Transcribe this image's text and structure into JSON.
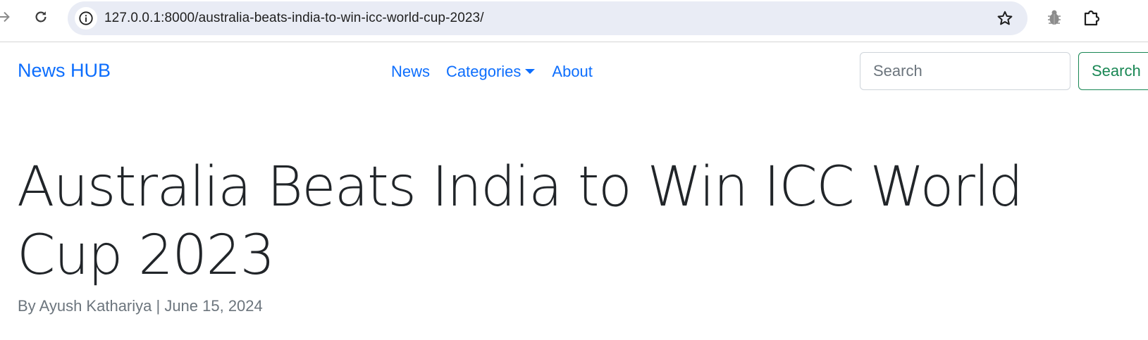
{
  "browser": {
    "url": "127.0.0.1:8000/australia-beats-india-to-win-icc-world-cup-2023/",
    "icons": {
      "forward": "arrow-right-icon",
      "reload": "reload-icon",
      "site_info": "info-icon",
      "bookmark": "star-icon",
      "extension_1": "bug-icon",
      "extension_2": "puzzle-icon"
    }
  },
  "navbar": {
    "brand": "News HUB",
    "links": {
      "news": "News",
      "categories": "Categories",
      "about": "About"
    },
    "search": {
      "placeholder": "Search",
      "value": "",
      "button_label": "Search"
    },
    "colors": {
      "link": "#0d6efd",
      "search_button": "#198754"
    }
  },
  "article": {
    "title": "Australia Beats India to Win ICC World Cup 2023",
    "byline": "By Ayush Kathariya | June 15, 2024"
  }
}
